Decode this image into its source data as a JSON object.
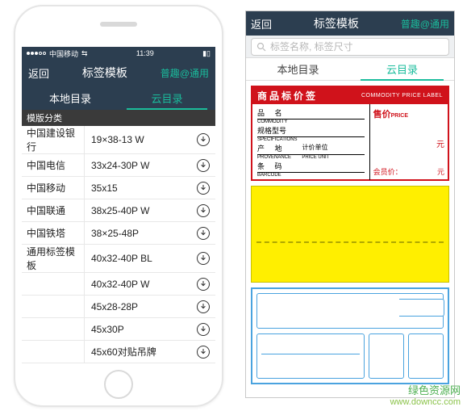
{
  "statusbar": {
    "carrier": "中国移动",
    "time": "11:39",
    "wifi": "⇆"
  },
  "nav": {
    "back": "返回",
    "title": "标签模板",
    "right": "普趣@通用"
  },
  "tabs": {
    "local": "本地目录",
    "cloud": "云目录"
  },
  "section_header": "模版分类",
  "categories": [
    "中国建设银行",
    "中国电信",
    "中国移动",
    "中国联通",
    "中国铁塔",
    "通用标签模板"
  ],
  "templates": [
    "19×38-13 W",
    "33x24-30P W",
    "35x15",
    "38x25-40P W",
    "38×25-48P",
    "40x32-40P BL",
    "40x32-40P W",
    "45x28-28P",
    "45x30P",
    "45x60对贴吊牌"
  ],
  "panel2": {
    "nav": {
      "back": "返回",
      "title": "标签模板",
      "right": "普趣@通用"
    },
    "search_placeholder": "标签名称, 标签尺寸",
    "tabs": {
      "local": "本地目录",
      "cloud": "云目录"
    }
  },
  "red_label": {
    "title_cn": "商品标价签",
    "title_en": "COMMODITY PRICE LABEL",
    "rows": [
      {
        "cn": "品   名",
        "en": "COMMODITY"
      },
      {
        "cn": "规格型号",
        "en": "SPECIFICATIONS"
      },
      {
        "cn": "产   地",
        "en": "PROVENANCE",
        "sub": "计价单位",
        "sub_en": "PRICE UNIT"
      },
      {
        "cn": "条   码",
        "en": "BARCODE"
      }
    ],
    "price": "售价",
    "price_en": "PRICE",
    "unit": "元",
    "member": "会员价：",
    "member_unit": "元"
  },
  "watermark": {
    "line1": "绿色资源网",
    "line2": "www.downcc.com"
  }
}
